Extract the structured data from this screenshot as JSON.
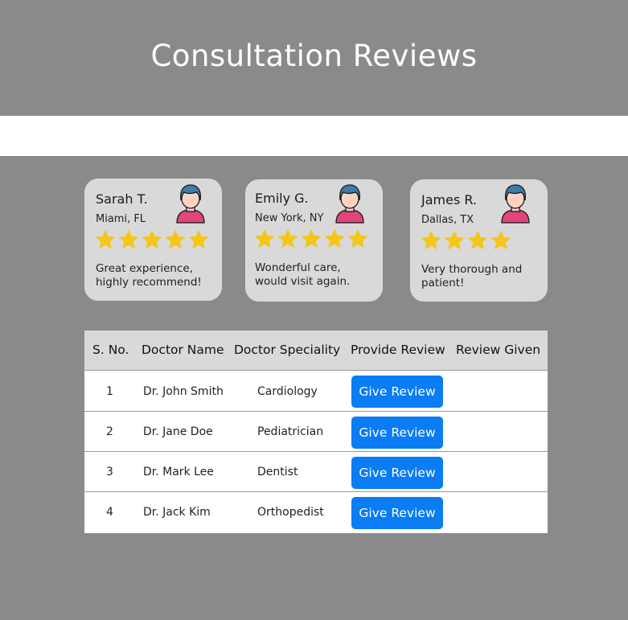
{
  "header": {
    "title": "Consultation Reviews"
  },
  "reviews": [
    {
      "name": "Sarah T.",
      "location": "Miami, FL",
      "rating": 5,
      "text": "Great experience, highly recommend!"
    },
    {
      "name": "Emily G.",
      "location": "New York, NY",
      "rating": 5,
      "text": "Wonderful care, would visit again."
    },
    {
      "name": "James R.",
      "location": "Dallas, TX",
      "rating": 4,
      "text": "Very thorough and patient!"
    }
  ],
  "table": {
    "headers": [
      "S. No.",
      "Doctor Name",
      "Doctor Speciality",
      "Provide Review",
      "Review Given"
    ],
    "rows": [
      {
        "sno": "1",
        "doctor": "Dr. John Smith",
        "speciality": "Cardiology",
        "action": "Give Review",
        "given": ""
      },
      {
        "sno": "2",
        "doctor": "Dr. Jane Doe",
        "speciality": "Pediatrician",
        "action": "Give Review",
        "given": ""
      },
      {
        "sno": "3",
        "doctor": "Dr. Mark Lee",
        "speciality": "Dentist",
        "action": "Give Review",
        "given": ""
      },
      {
        "sno": "4",
        "doctor": "Dr. Jack Kim",
        "speciality": "Orthopedist",
        "action": "Give Review",
        "given": ""
      }
    ]
  },
  "icons": {
    "avatar": "avatar-icon",
    "star": "star-icon"
  },
  "colors": {
    "button": "#0a7cf4",
    "star": "#f5c518",
    "card": "#d9d9d9",
    "background": "#8a8a8a"
  }
}
